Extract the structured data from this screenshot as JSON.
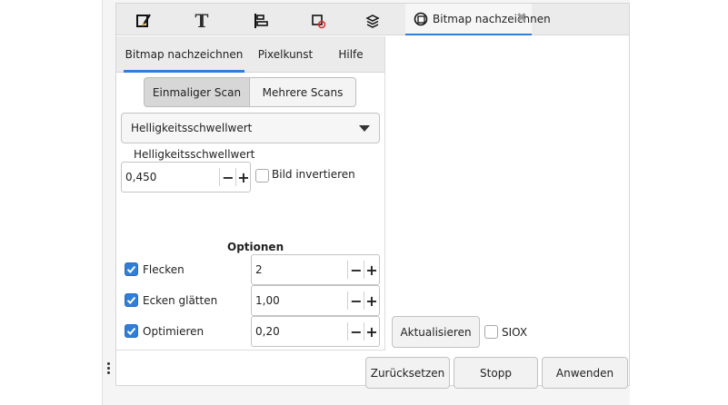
{
  "toolbar": {
    "tools": [
      {
        "name": "fill-and-stroke",
        "icon": "pen-paint-icon"
      },
      {
        "name": "text-and-font",
        "icon": "text-T-icon",
        "glyph": "T"
      },
      {
        "name": "align-and-distribute",
        "icon": "align-icon"
      },
      {
        "name": "transform",
        "icon": "transform-icon"
      },
      {
        "name": "layers",
        "icon": "layers-icon"
      }
    ],
    "active_tab": {
      "label": "Bitmap nachzeichnen",
      "icon": "trace-bitmap-icon",
      "close": "✖"
    }
  },
  "notebook": {
    "tabs": [
      "Bitmap nachzeichnen",
      "Pixelkunst",
      "Hilfe"
    ],
    "active": 0
  },
  "scan_mode": {
    "options": [
      "Einmaliger Scan",
      "Mehrere Scans"
    ],
    "selected": 0
  },
  "mode_select": {
    "value": "Helligkeitsschwellwert"
  },
  "threshold": {
    "label": "Helligkeitsschwellwert",
    "value": "0,450",
    "invert_label": "Bild invertieren",
    "invert_checked": false
  },
  "options": {
    "heading": "Optionen",
    "rows": [
      {
        "label": "Flecken",
        "checked": true,
        "value": "2"
      },
      {
        "label": "Ecken glätten",
        "checked": true,
        "value": "1,00"
      },
      {
        "label": "Optimieren",
        "checked": true,
        "value": "0,20"
      }
    ]
  },
  "preview": {
    "update_label": "Aktualisieren",
    "siox_label": "SIOX",
    "siox_checked": false
  },
  "actions": {
    "reset": "Zurücksetzen",
    "stop": "Stopp",
    "apply": "Anwenden"
  },
  "spin": {
    "minus": "−",
    "plus": "+"
  },
  "colors": {
    "accent": "#2f7ed8",
    "panel": "#f5f5f5",
    "tabbar": "#ebebeb"
  }
}
